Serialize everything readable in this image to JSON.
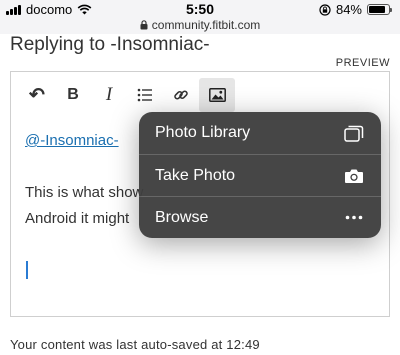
{
  "status_bar": {
    "carrier": "docomo",
    "time": "5:50",
    "url": "community.fitbit.com",
    "battery_percent": "84%",
    "battery_level": 0.84
  },
  "reply": {
    "title": "Replying to -Insomniac-",
    "preview_label": "PREVIEW"
  },
  "toolbar": {
    "buttons": [
      {
        "name": "undo",
        "icon": "undo-icon",
        "glyph": "↶"
      },
      {
        "name": "bold",
        "icon": "bold-icon",
        "glyph": "B"
      },
      {
        "name": "italic",
        "icon": "italic-icon",
        "glyph": "I"
      },
      {
        "name": "bulleted-list",
        "icon": "list-icon"
      },
      {
        "name": "link",
        "icon": "link-icon"
      },
      {
        "name": "insert-image",
        "icon": "image-icon"
      }
    ]
  },
  "editor": {
    "mention": "@-Insomniac-",
    "line1": "This is what show",
    "line2": "Android it might"
  },
  "popup": {
    "items": [
      {
        "label": "Photo Library",
        "icon": "photo-library-icon"
      },
      {
        "label": "Take Photo",
        "icon": "camera-icon"
      },
      {
        "label": "Browse",
        "icon": "more-icon"
      }
    ]
  },
  "autosave": "Your content was last auto-saved at 12:49"
}
